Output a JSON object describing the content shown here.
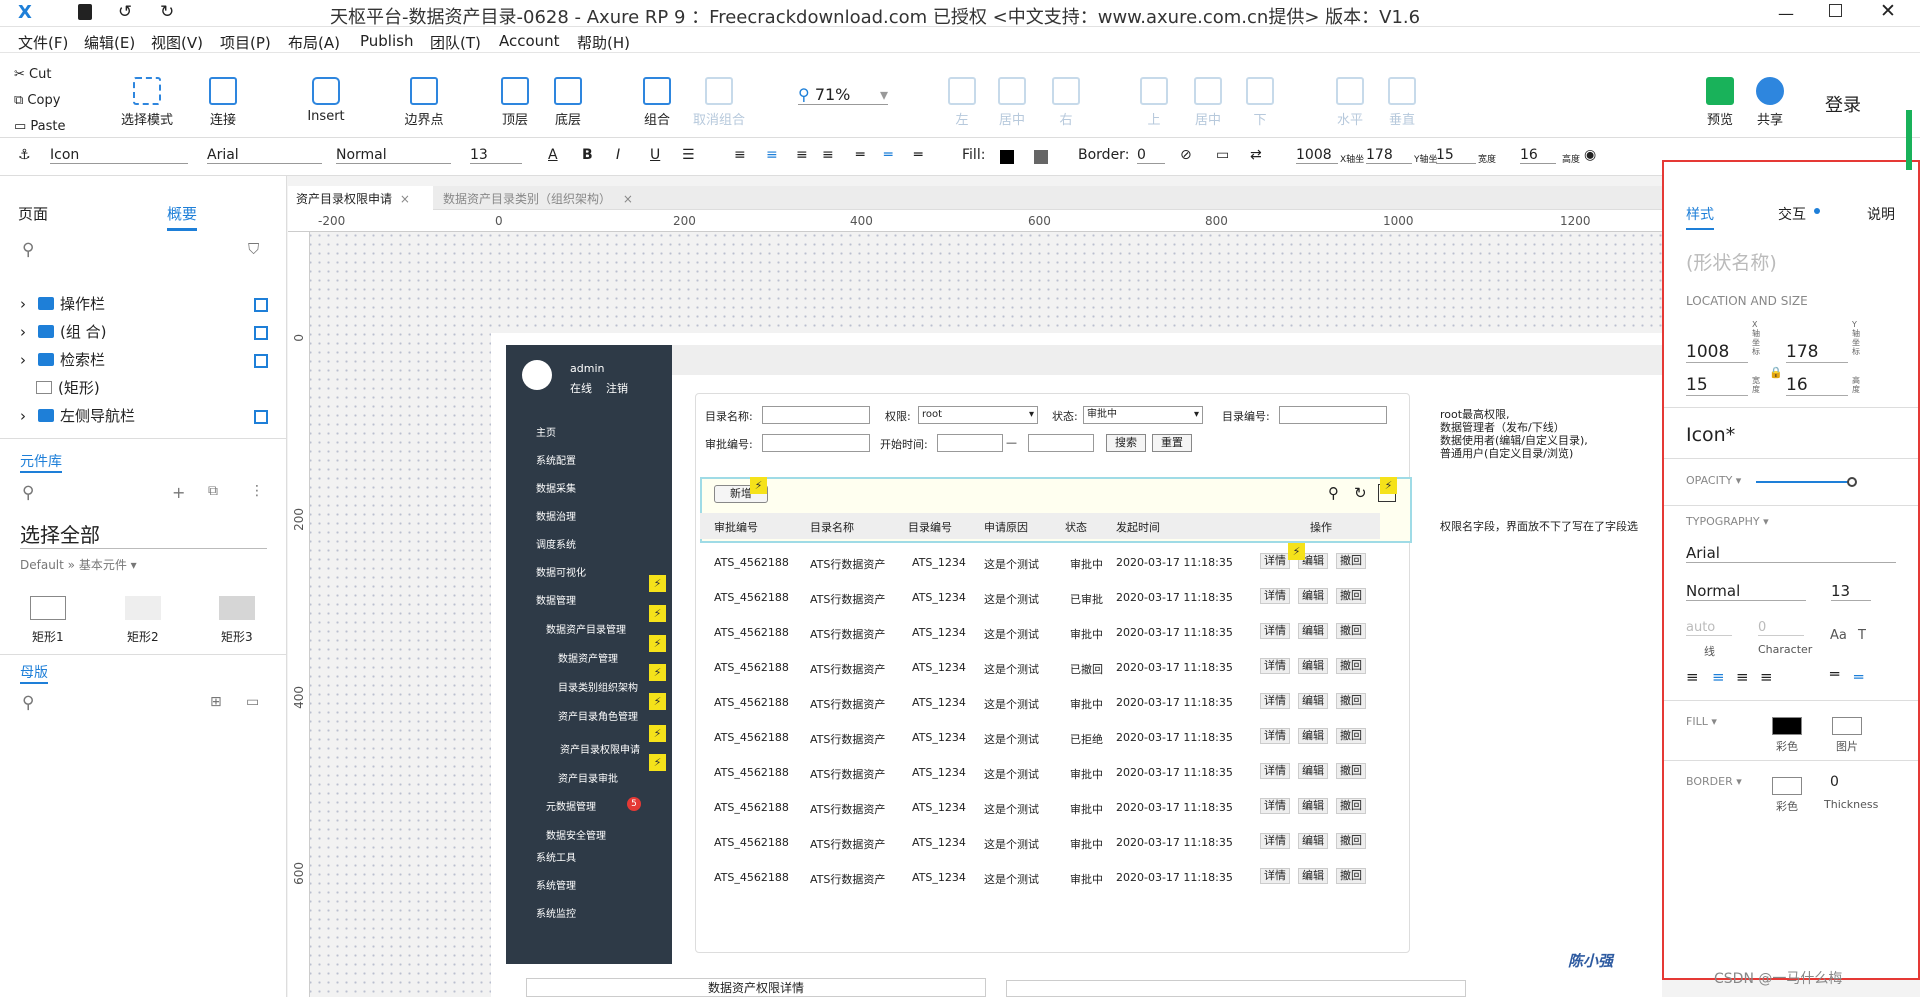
{
  "window": {
    "title": "天枢平台-数据资产目录-0628 - Axure RP 9 ：Freecrackdownload.com 已授权 <中文支持：www.axure.com.cn提供> 版本：V1.6"
  },
  "menu": [
    "文件(F)",
    "编辑(E)",
    "视图(V)",
    "项目(P)",
    "布局(A)",
    "Publish",
    "团队(T)",
    "Account",
    "帮助(H)"
  ],
  "clipboard": {
    "cut": "Cut",
    "copy": "Copy",
    "paste": "Paste"
  },
  "toolbar": {
    "select_mode": "选择模式",
    "connect": "连接",
    "insert": "Insert",
    "point": "边界点",
    "top": "顶层",
    "bottom": "底层",
    "group": "组合",
    "ungroup": "取消组合",
    "left": "左",
    "hcenter": "居中",
    "right": "右",
    "up": "上",
    "vcenter": "居中",
    "down": "下",
    "horizontal": "水平",
    "vertical": "垂直",
    "zoom": "71%",
    "preview": "预览",
    "share": "共享",
    "login": "登录"
  },
  "format": {
    "widget": "Icon",
    "font": "Arial",
    "weight": "Normal",
    "size": "13",
    "fill_label": "Fill:",
    "border_label": "Border:",
    "border_val": "0",
    "x": "1008",
    "x_label": "X轴坐",
    "y": "178",
    "y_label": "Y轴坐",
    "w": "15",
    "w_label": "宽度",
    "h": "16",
    "h_label": "高度"
  },
  "leftpanel": {
    "tab_pages": "页面",
    "tab_outline": "概要",
    "outline_items": [
      "操作栏",
      "(组 合)",
      "检索栏",
      "(矩形)",
      "左侧导航栏"
    ],
    "library_title": "元件库",
    "library_select": "选择全部",
    "library_path": "Default » 基本元件 ▾",
    "library_items": [
      "矩形1",
      "矩形2",
      "矩形3"
    ],
    "masters_title": "母版"
  },
  "tabs": [
    "资产目录权限申请",
    "数据资产目录类别（组织架构）"
  ],
  "ruler": {
    "h": [
      "-200",
      "0",
      "200",
      "400",
      "600",
      "800",
      "1000",
      "1200"
    ],
    "v": [
      "0",
      "200",
      "400",
      "600"
    ]
  },
  "app": {
    "user": "admin",
    "status": "在线",
    "logout": "注销",
    "nav": [
      "主页",
      "系统配置",
      "数据采集",
      "数据治理",
      "调度系统",
      "数据可视化",
      "数据管理",
      "数据资产目录管理",
      "数据资产管理",
      "目录类别组织架构",
      "资产目录角色管理",
      "资产目录权限申请",
      "资产目录审批",
      "元数据管理",
      "数据安全管理",
      "系统工具",
      "系统管理",
      "系统监控"
    ],
    "badge": "5",
    "filters": {
      "name": "目录名称:",
      "perm": "权限:",
      "perm_val": "root",
      "state": "状态:",
      "state_val": "审批中",
      "code": "目录编号:",
      "appr": "审批编号:",
      "start": "开始时间:",
      "dash": "—",
      "search": "搜索",
      "reset": "重置"
    },
    "add": "新增",
    "headers": [
      "审批编号",
      "目录名称",
      "目录编号",
      "申请原因",
      "状态",
      "发起时间",
      "操作"
    ],
    "rows": [
      [
        "ATS_4562188",
        "ATS行数据资产",
        "ATS_1234",
        "这是个测试",
        "审批中",
        "2020-03-17 11:18:35"
      ],
      [
        "ATS_4562188",
        "ATS行数据资产",
        "ATS_1234",
        "这是个测试",
        "已审批",
        "2020-03-17 11:18:35"
      ],
      [
        "ATS_4562188",
        "ATS行数据资产",
        "ATS_1234",
        "这是个测试",
        "审批中",
        "2020-03-17 11:18:35"
      ],
      [
        "ATS_4562188",
        "ATS行数据资产",
        "ATS_1234",
        "这是个测试",
        "已撤回",
        "2020-03-17 11:18:35"
      ],
      [
        "ATS_4562188",
        "ATS行数据资产",
        "ATS_1234",
        "这是个测试",
        "审批中",
        "2020-03-17 11:18:35"
      ],
      [
        "ATS_4562188",
        "ATS行数据资产",
        "ATS_1234",
        "这是个测试",
        "已拒绝",
        "2020-03-17 11:18:35"
      ],
      [
        "ATS_4562188",
        "ATS行数据资产",
        "ATS_1234",
        "这是个测试",
        "审批中",
        "2020-03-17 11:18:35"
      ],
      [
        "ATS_4562188",
        "ATS行数据资产",
        "ATS_1234",
        "这是个测试",
        "审批中",
        "2020-03-17 11:18:35"
      ],
      [
        "ATS_4562188",
        "ATS行数据资产",
        "ATS_1234",
        "这是个测试",
        "审批中",
        "2020-03-17 11:18:35"
      ],
      [
        "ATS_4562188",
        "ATS行数据资产",
        "ATS_1234",
        "这是个测试",
        "审批中",
        "2020-03-17 11:18:35"
      ]
    ],
    "ops": [
      "详情",
      "编辑",
      "撤回"
    ],
    "note1": [
      "root最高权限,",
      "数据管理者（发布/下线）",
      "数据使用者(编辑/自定义目录),",
      "普通用户(自定义目录/浏览)"
    ],
    "note2": "权限名字段，界面放不下了写在了字段选",
    "bottom_label": "数据资产权限详情",
    "sign": "陈小强"
  },
  "rightpanel": {
    "tabs": [
      "样式",
      "交互",
      "说明"
    ],
    "shape_name": "(形状名称)",
    "loc_title": "LOCATION AND SIZE",
    "x": "1008",
    "x_lab": "X轴坐标",
    "y": "178",
    "y_lab": "Y轴坐标",
    "w": "15",
    "w_lab": "宽度",
    "h": "16",
    "h_lab": "高度",
    "style_name": "Icon*",
    "opacity": "OPACITY ▾",
    "opacity_value": 1.0,
    "typo": "TYPOGRAPHY ▾",
    "font": "Arial",
    "weight": "Normal",
    "size": "13",
    "line_ph": "auto",
    "line_lab": "线",
    "char_val": "0",
    "char_lab": "Character",
    "fill_title": "FILL ▾",
    "fill_color": "彩色",
    "fill_img": "图片",
    "border_title": "BORDER ▾",
    "border_color": "彩色",
    "thick": "0",
    "thick_lab": "Thickness"
  },
  "watermark": "CSDN @一马什么梅"
}
